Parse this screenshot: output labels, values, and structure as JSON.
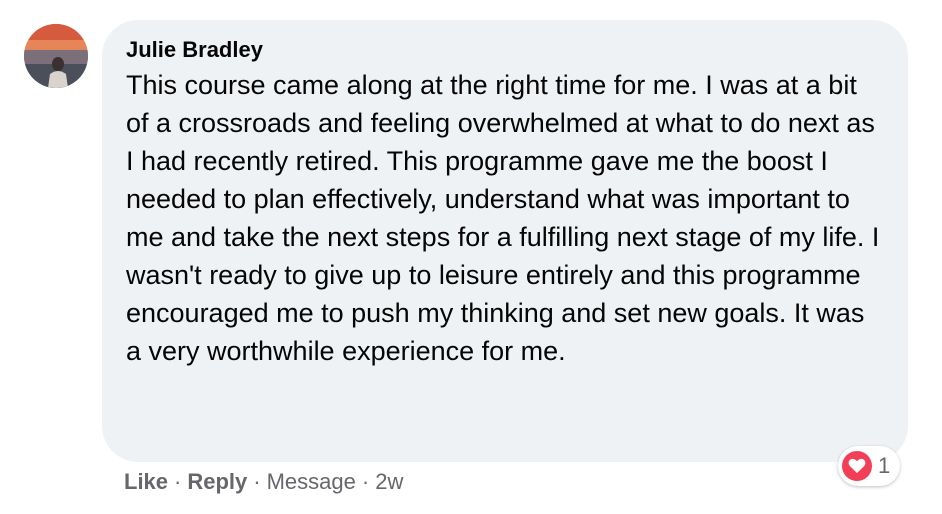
{
  "comment": {
    "author": "Julie Bradley",
    "text": "This course came along at the right time for me. I was at a bit of a crossroads and feeling overwhelmed at what to do next as I had recently retired. This programme gave me the boost I needed to plan effectively, understand what was important to me and take the next steps for a fulfilling next stage of my life. I wasn't ready to give up to leisure entirely and this programme encouraged me to push my thinking and set new goals. It was a very worthwhile experience for me."
  },
  "actions": {
    "like_label": "Like",
    "reply_label": "Reply",
    "message_label": "Message",
    "separator": "·",
    "timestamp": "2w"
  },
  "reactions": {
    "icon": "heart-icon",
    "count": "1",
    "color": "#f33e58"
  },
  "colors": {
    "bubble_bg": "#eff2f5",
    "secondary_text": "#65676b"
  }
}
